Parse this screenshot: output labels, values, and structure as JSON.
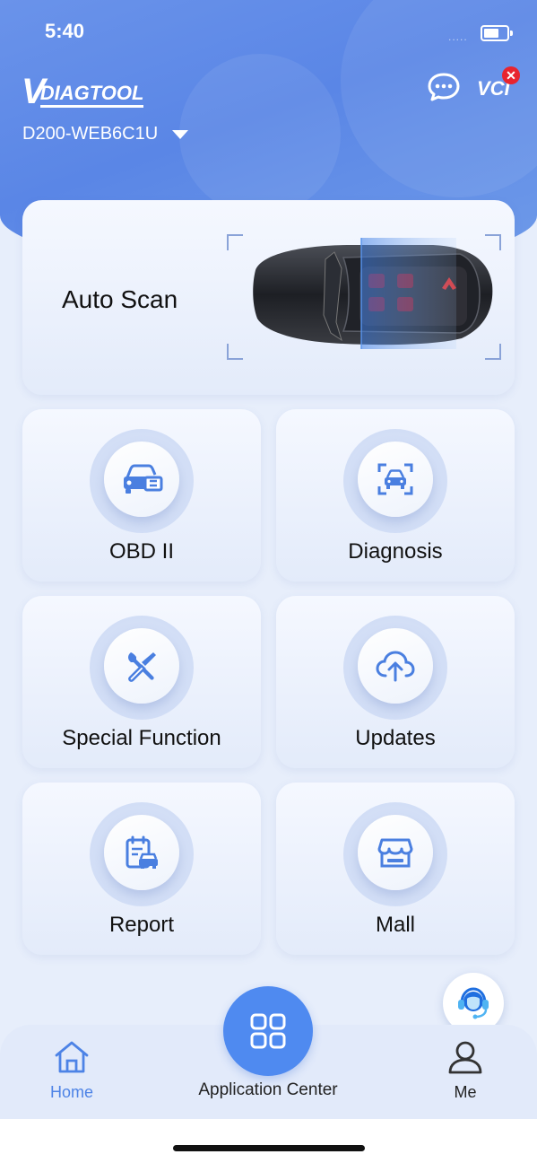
{
  "status_bar": {
    "time": "5:40",
    "signal": "....."
  },
  "header": {
    "logo_mark": "V",
    "logo_text": "DIAGTOOL",
    "device_name": "D200-WEB6C1U",
    "vci_label": "VCI",
    "vci_badge": "✕"
  },
  "auto_scan": {
    "label": "Auto Scan"
  },
  "tiles": [
    {
      "label": "OBD II",
      "icon": "car-engine-icon"
    },
    {
      "label": "Diagnosis",
      "icon": "car-scan-icon"
    },
    {
      "label": "Special Function",
      "icon": "tools-icon"
    },
    {
      "label": "Updates",
      "icon": "cloud-upload-icon"
    },
    {
      "label": "Report",
      "icon": "report-car-icon"
    },
    {
      "label": "Mall",
      "icon": "store-icon"
    }
  ],
  "tabbar": {
    "home": "Home",
    "center": "Application Center",
    "me": "Me"
  },
  "colors": {
    "accent": "#4f8af0",
    "hero": "#5a86e6",
    "error": "#e8242f"
  }
}
